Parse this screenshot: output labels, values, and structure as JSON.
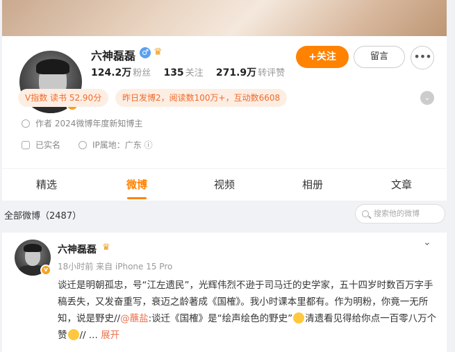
{
  "profile": {
    "name": "六神磊磊",
    "fans_value": "124.2万",
    "fans_label": "粉丝",
    "following_value": "135",
    "following_label": "关注",
    "likes_value": "271.9万",
    "likes_label": "转评赞",
    "follow_button": "+关注",
    "message_button": "留言",
    "more_button": "•••",
    "verified_badge": "v"
  },
  "tags": {
    "v_index": "V指数 读书 52.90分",
    "activity": "昨日发博2，阅读数100万+，互动数6608"
  },
  "info": {
    "author": "作者 2024微博年度新知博主",
    "realname": "已实名",
    "ip": "IP属地：广东 ⓘ"
  },
  "tabs": [
    "精选",
    "微博",
    "视频",
    "相册",
    "文章"
  ],
  "feed": {
    "count_label": "全部微博（2487）",
    "search_placeholder": "搜索他的微博"
  },
  "post": {
    "name": "六神磊磊",
    "meta": "18小时前 来自 iPhone 15 Pro",
    "text_1": "谈迁是明朝孤忠，号“江左遗民”，光辉伟烈不逊于司马迁的史学家，五十四岁时数百万字手稿丢失，又发奋重写，衰迈之龄著成《国榷》。我小时课本里都有。作为明粉，你竟一无所知，说是野史//",
    "mention": "@蘸盐",
    "text_2": ":谈迁《国榷》是“绘声绘色的野史”",
    "text_3": "清遗看见得给你点一百零八万个赞",
    "text_4": "// ...",
    "expand": "展开"
  },
  "colors": {
    "accent": "#ff8200",
    "tag_bg": "#fdeee4",
    "tag_text": "#f06a28",
    "link": "#eb7350"
  }
}
